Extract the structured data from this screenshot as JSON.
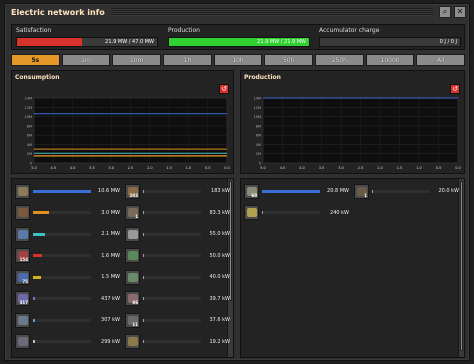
{
  "window": {
    "title": "Electric network info"
  },
  "titlebar_icons": [
    "search-icon",
    "close-icon"
  ],
  "stats": {
    "satisfaction": {
      "label": "Satisfaction",
      "text": "21.9 MW / 47.0 MW",
      "fraction": 0.466,
      "color": "#d8322d"
    },
    "production": {
      "label": "Production",
      "text": "21.9 MW / 21.9 MW",
      "fraction": 1.0,
      "color": "#30d030"
    },
    "accumulator": {
      "label": "Accumulator charge",
      "text": "0 J / 0 J",
      "fraction": 0.0,
      "color": "#555555"
    }
  },
  "tabs": [
    {
      "label": "5s",
      "active": true
    },
    {
      "label": "1m",
      "active": false
    },
    {
      "label": "10m",
      "active": false
    },
    {
      "label": "1h",
      "active": false
    },
    {
      "label": "10h",
      "active": false
    },
    {
      "label": "50h",
      "active": false
    },
    {
      "label": "250h",
      "active": false
    },
    {
      "label": "1000h",
      "active": false
    },
    {
      "label": "All",
      "active": false
    }
  ],
  "consumption": {
    "label": "Consumption",
    "y_ticks": [
      "14M",
      "12M",
      "10M",
      "8M",
      "6M",
      "4M",
      "2M",
      "0"
    ],
    "x_ticks": [
      "5.0",
      "4.5",
      "4.0",
      "3.5",
      "3.0",
      "2.5",
      "2.0",
      "1.5",
      "1.0",
      "0.5",
      "0.0"
    ]
  },
  "production_graph": {
    "label": "Production",
    "y_ticks": [
      "14M",
      "12M",
      "10M",
      "8M",
      "6M",
      "4M",
      "2M",
      "0"
    ],
    "x_ticks": [
      "5.0",
      "4.5",
      "4.0",
      "3.5",
      "3.0",
      "2.5",
      "2.0",
      "1.5",
      "1.0",
      "0.5",
      "0.0"
    ]
  },
  "chart_data": [
    {
      "type": "line",
      "title": "Consumption",
      "x": [
        5.0,
        4.5,
        4.0,
        3.5,
        3.0,
        2.5,
        2.0,
        1.5,
        1.0,
        0.5,
        0.0
      ],
      "ylim": [
        0,
        14
      ],
      "series": [
        {
          "color": "#3a6fd8",
          "values": [
            10.6,
            10.6,
            10.6,
            10.6,
            10.6,
            10.6,
            10.6,
            10.6,
            10.6,
            10.6,
            10.6
          ]
        },
        {
          "color": "#e0901c",
          "values": [
            3.0,
            3.0,
            3.0,
            3.0,
            3.0,
            3.0,
            3.0,
            3.0,
            3.0,
            3.0,
            3.0
          ]
        },
        {
          "color": "#3cc0c0",
          "values": [
            2.1,
            2.1,
            2.1,
            2.1,
            2.1,
            2.1,
            2.1,
            2.1,
            2.1,
            2.1,
            2.1
          ]
        },
        {
          "color": "#d8322d",
          "values": [
            1.6,
            1.6,
            1.6,
            1.6,
            1.6,
            1.6,
            1.6,
            1.6,
            1.6,
            1.6,
            1.6
          ]
        },
        {
          "color": "#d8b020",
          "values": [
            1.5,
            1.5,
            1.5,
            1.5,
            1.5,
            1.5,
            1.5,
            1.5,
            1.5,
            1.5,
            1.5
          ]
        }
      ]
    },
    {
      "type": "line",
      "title": "Production",
      "x": [
        5.0,
        4.5,
        4.0,
        3.5,
        3.0,
        2.5,
        2.0,
        1.5,
        1.0,
        0.5,
        0.0
      ],
      "ylim": [
        0,
        14
      ],
      "series": [
        {
          "color": "#3a6fd8",
          "values": [
            20.8,
            20.8,
            20.8,
            20.8,
            20.8,
            20.8,
            20.8,
            20.8,
            20.8,
            20.8,
            20.8
          ]
        }
      ]
    }
  ],
  "consumers": [
    {
      "icon": "assembler-icon",
      "color": "#8a7a5a",
      "count": "",
      "value": "10.6 MW",
      "fraction": 1.0,
      "bar": "#3a6fd8"
    },
    {
      "icon": "furnace-icon",
      "color": "#7a5a3a",
      "count": "",
      "value": "3.0 MW",
      "fraction": 0.28,
      "bar": "#e0901c"
    },
    {
      "icon": "radar-icon",
      "color": "#5a7aa8",
      "count": "",
      "value": "2.1 MW",
      "fraction": 0.2,
      "bar": "#3cc0c0"
    },
    {
      "icon": "inserter-icon",
      "color": "#a04040",
      "count": "154",
      "value": "1.6 MW",
      "fraction": 0.15,
      "bar": "#d8322d"
    },
    {
      "icon": "fast-inserter-icon",
      "color": "#4a6aa8",
      "count": "75",
      "value": "1.5 MW",
      "fraction": 0.14,
      "bar": "#d8b020"
    },
    {
      "icon": "filter-inserter-icon",
      "color": "#6a6aa8",
      "count": "317",
      "value": "437 kW",
      "fraction": 0.04,
      "bar": "#8a6ad0"
    },
    {
      "icon": "lab-icon",
      "color": "#6a7a8a",
      "count": "",
      "value": "307 kW",
      "fraction": 0.03,
      "bar": "#60a0d0"
    },
    {
      "icon": "beacon-icon",
      "color": "#6a6a7a",
      "count": "",
      "value": "299 kW",
      "fraction": 0.03,
      "bar": "#c0c0c0"
    }
  ],
  "consumers2": [
    {
      "icon": "mining-drill-icon",
      "color": "#8a6a4a",
      "count": "283",
      "value": "183 kW",
      "fraction": 0.02,
      "bar": "#a0a0a0"
    },
    {
      "icon": "pump-icon",
      "color": "#7a6a5a",
      "count": "1",
      "value": "83.3 kW",
      "fraction": 0.01,
      "bar": "#a0a0a0"
    },
    {
      "icon": "roboport-icon",
      "color": "#9a9a9a",
      "count": "",
      "value": "55.0 kW",
      "fraction": 0.005,
      "bar": "#a0a0a0"
    },
    {
      "icon": "chemical-plant-icon",
      "color": "#5a8a5a",
      "count": "",
      "value": "50.0 kW",
      "fraction": 0.005,
      "bar": "#a0a0a0"
    },
    {
      "icon": "refinery-icon",
      "color": "#6a8a6a",
      "count": "",
      "value": "40.0 kW",
      "fraction": 0.004,
      "bar": "#a0a0a0"
    },
    {
      "icon": "centrifuge-icon",
      "color": "#8a6a6a",
      "count": "86",
      "value": "39.7 kW",
      "fraction": 0.004,
      "bar": "#a0a0a0"
    },
    {
      "icon": "lamp-icon",
      "color": "#6a6a6a",
      "count": "11",
      "value": "37.6 kW",
      "fraction": 0.004,
      "bar": "#a0a0a0"
    },
    {
      "icon": "turret-icon",
      "color": "#8a7a4a",
      "count": "",
      "value": "19.2 kW",
      "fraction": 0.002,
      "bar": "#a0a0a0"
    }
  ],
  "producers": [
    {
      "icon": "steam-engine-icon",
      "color": "#8a8a7a",
      "count": "60",
      "value": "20.8 MW",
      "fraction": 1.0,
      "bar": "#3a6fd8"
    },
    {
      "icon": "solar-panel-icon",
      "color": "#b0a050",
      "count": "",
      "value": "240 kW",
      "fraction": 0.012,
      "bar": "#a0a0a0"
    }
  ],
  "producers2": [
    {
      "icon": "steam-turbine-icon",
      "color": "#6a5a4a",
      "count": "1",
      "value": "20.0 kW",
      "fraction": 0.001,
      "bar": "#a0a0a0"
    }
  ]
}
